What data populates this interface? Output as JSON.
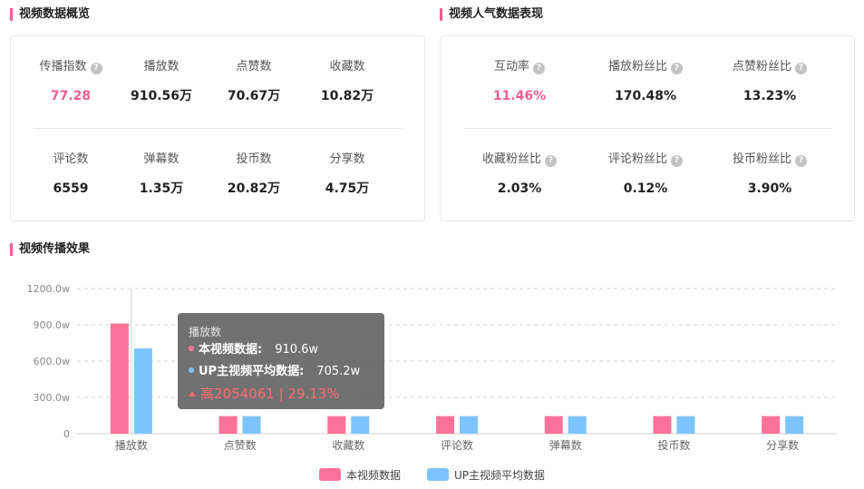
{
  "overview": {
    "title": "视频数据概览",
    "stats": [
      {
        "label": "传播指数",
        "value": "77.28",
        "help": true,
        "highlight": true
      },
      {
        "label": "播放数",
        "value": "910.56万",
        "help": false,
        "highlight": false
      },
      {
        "label": "点赞数",
        "value": "70.67万",
        "help": false,
        "highlight": false
      },
      {
        "label": "收藏数",
        "value": "10.82万",
        "help": false,
        "highlight": false
      },
      {
        "label": "评论数",
        "value": "6559",
        "help": false,
        "highlight": false
      },
      {
        "label": "弹幕数",
        "value": "1.35万",
        "help": false,
        "highlight": false
      },
      {
        "label": "投币数",
        "value": "20.82万",
        "help": false,
        "highlight": false
      },
      {
        "label": "分享数",
        "value": "4.75万",
        "help": false,
        "highlight": false
      }
    ]
  },
  "popularity": {
    "title": "视频人气数据表现",
    "stats": [
      {
        "label": "互动率",
        "value": "11.46%",
        "help": true,
        "highlight": true
      },
      {
        "label": "播放粉丝比",
        "value": "170.48%",
        "help": true,
        "highlight": false
      },
      {
        "label": "点赞粉丝比",
        "value": "13.23%",
        "help": true,
        "highlight": false
      },
      {
        "label": "收藏粉丝比",
        "value": "2.03%",
        "help": true,
        "highlight": false
      },
      {
        "label": "评论粉丝比",
        "value": "0.12%",
        "help": true,
        "highlight": false
      },
      {
        "label": "投币粉丝比",
        "value": "3.90%",
        "help": true,
        "highlight": false
      }
    ]
  },
  "help_glyph": "?",
  "spread": {
    "title": "视频传播效果"
  },
  "chart_data": {
    "type": "bar",
    "categories": [
      "播放数",
      "点赞数",
      "收藏数",
      "评论数",
      "弹幕数",
      "投币数",
      "分享数"
    ],
    "series": [
      {
        "name": "本视频数据",
        "values": [
          910.6,
          145,
          145,
          145,
          145,
          145,
          145
        ],
        "color": "#fb7299"
      },
      {
        "name": "UP主视频平均数据",
        "values": [
          705.2,
          145,
          145,
          145,
          145,
          145,
          145
        ],
        "color": "#7dc4fc"
      }
    ],
    "ylim": [
      0,
      1200
    ],
    "y_ticks": [
      0,
      300,
      600,
      900,
      1200
    ],
    "y_tick_labels": [
      "0",
      "300.0w",
      "600.0w",
      "900.0w",
      "1200.0w"
    ],
    "grid": true,
    "legend_position": "bottom-center"
  },
  "tooltip": {
    "title": "播放数",
    "rows": [
      {
        "label": "本视频数据:",
        "value": "910.6w",
        "color": "#fb7299"
      },
      {
        "label": "UP主视频平均数据:",
        "value": "705.2w",
        "color": "#7dc4fc"
      }
    ],
    "diff": "高2054061 | 29.13%"
  }
}
